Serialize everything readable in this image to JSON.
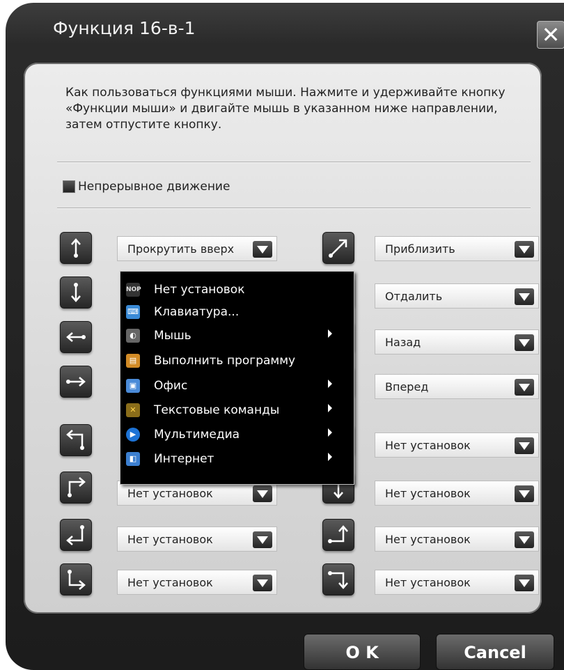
{
  "window": {
    "title": "Функция 16-в-1",
    "close_label": "✕"
  },
  "instructions": "Как пользоваться функциями мыши. Нажмите и удерживайте кнопку «Функции мыши» и двигайте мышь в указанном ниже направлении, затем отпустите кнопку.",
  "continuous": {
    "label": "Непрерывное движение",
    "checked": false
  },
  "left_column": [
    {
      "gesture": "up",
      "value": "Прокрутить вверх"
    },
    {
      "gesture": "down",
      "value": ""
    },
    {
      "gesture": "left",
      "value": ""
    },
    {
      "gesture": "right",
      "value": ""
    },
    {
      "gesture": "up-left",
      "value": ""
    },
    {
      "gesture": "up-right",
      "value": "Нет установок"
    },
    {
      "gesture": "right-down-left",
      "value": "Нет установок"
    },
    {
      "gesture": "down-right",
      "value": "Нет установок"
    }
  ],
  "right_column": [
    {
      "gesture": "diagonal-up-right",
      "value": "Приблизить"
    },
    {
      "gesture": "",
      "value": "Отдалить"
    },
    {
      "gesture": "",
      "value": "Назад"
    },
    {
      "gesture": "",
      "value": "Вперед"
    },
    {
      "gesture": "",
      "value": "Нет установок"
    },
    {
      "gesture": "",
      "value": "Нет установок"
    },
    {
      "gesture": "right-up",
      "value": "Нет установок"
    },
    {
      "gesture": "right-down",
      "value": "Нет установок"
    }
  ],
  "menu": {
    "items": [
      {
        "label": "Нет установок",
        "icon": "nop-icon",
        "submenu": false
      },
      {
        "label": "Клавиатура...",
        "icon": "keyboard-icon",
        "submenu": false
      },
      {
        "label": "Мышь",
        "icon": "mouse-icon",
        "submenu": true
      },
      {
        "label": "Выполнить программу",
        "icon": "run-program-icon",
        "submenu": false
      },
      {
        "label": "Офис",
        "icon": "office-icon",
        "submenu": true
      },
      {
        "label": "Текстовые команды",
        "icon": "text-commands-icon",
        "submenu": true
      },
      {
        "label": "Мультимедиа",
        "icon": "multimedia-icon",
        "submenu": true
      },
      {
        "label": "Интернет",
        "icon": "internet-icon",
        "submenu": true
      }
    ]
  },
  "buttons": {
    "ok": "O K",
    "cancel": "Cancel"
  }
}
